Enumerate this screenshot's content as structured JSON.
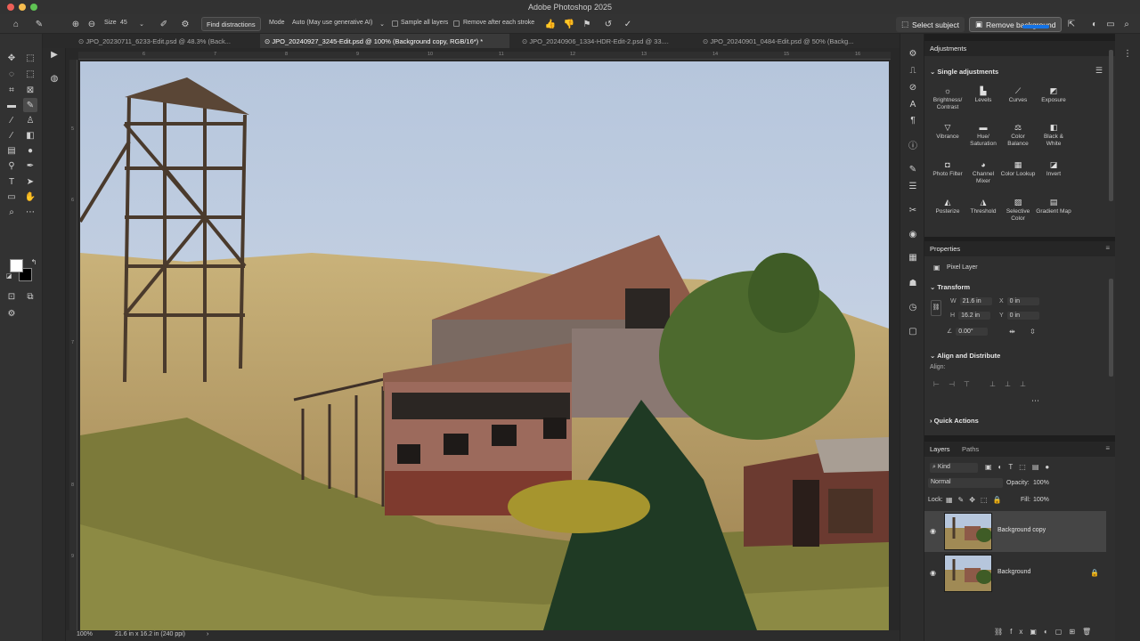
{
  "app": {
    "title": "Adobe Photoshop 2025"
  },
  "options": {
    "size_label": "Size",
    "size_value": "45",
    "find_distractions": "Find distractions",
    "mode_label": "Mode",
    "mode_value": "Auto (May use generative AI)",
    "sample_all_layers": "Sample all layers",
    "remove_after_stroke": "Remove after each stroke",
    "select_subject": "Select subject",
    "remove_background": "Remove background"
  },
  "tabs": [
    {
      "label": "JPO_20230711_6233-Edit.psd @ 48.3% (Back..."
    },
    {
      "label": "JPO_20240927_3245-Edit.psd @ 100% (Background copy, RGB/16*) *"
    },
    {
      "label": "JPO_20240906_1334-HDR-Edit-2.psd @ 33...."
    },
    {
      "label": "JPO_20240901_0484-Edit.psd @ 50% (Backg..."
    }
  ],
  "ruler": {
    "top": [
      "6",
      "7",
      "8",
      "9",
      "10",
      "11",
      "12",
      "13",
      "14",
      "15",
      "16"
    ],
    "left": [
      "5",
      "6",
      "7",
      "8",
      "9"
    ]
  },
  "status": {
    "zoom": "100%",
    "doc_size": "21.6 in x 16.2 in (240 ppi)"
  },
  "adjustments": {
    "title": "Adjustments",
    "section": "Single adjustments",
    "items": [
      {
        "label": "Brightness/ Contrast",
        "icon": "sun-icon"
      },
      {
        "label": "Levels",
        "icon": "levels-icon"
      },
      {
        "label": "Curves",
        "icon": "curves-icon"
      },
      {
        "label": "Exposure",
        "icon": "exposure-icon"
      },
      {
        "label": "Vibrance",
        "icon": "vibrance-icon"
      },
      {
        "label": "Hue/ Saturation",
        "icon": "hue-icon"
      },
      {
        "label": "Color Balance",
        "icon": "balance-icon"
      },
      {
        "label": "Black & White",
        "icon": "bw-icon"
      },
      {
        "label": "Photo Filter",
        "icon": "camera-icon"
      },
      {
        "label": "Channel Mixer",
        "icon": "mixer-icon"
      },
      {
        "label": "Color Lookup",
        "icon": "grid-icon"
      },
      {
        "label": "Invert",
        "icon": "invert-icon"
      },
      {
        "label": "Posterize",
        "icon": "posterize-icon"
      },
      {
        "label": "Threshold",
        "icon": "threshold-icon"
      },
      {
        "label": "Selective Color",
        "icon": "selective-icon"
      },
      {
        "label": "Gradient Map",
        "icon": "gradient-icon"
      }
    ]
  },
  "properties": {
    "title": "Properties",
    "layer_type": "Pixel Layer",
    "transform_label": "Transform",
    "w_label": "W",
    "w_value": "21.6 in",
    "h_label": "H",
    "h_value": "16.2 in",
    "x_label": "X",
    "x_value": "0 in",
    "y_label": "Y",
    "y_value": "0 in",
    "angle_value": "0.00°",
    "align_label": "Align and Distribute",
    "align_sub": "Align:",
    "quick_actions": "Quick Actions"
  },
  "layers": {
    "tab_layers": "Layers",
    "tab_paths": "Paths",
    "kind": "Kind",
    "blend_mode": "Normal",
    "opacity_label": "Opacity:",
    "opacity_value": "100%",
    "lock_label": "Lock:",
    "fill_label": "Fill:",
    "fill_value": "100%",
    "items": [
      {
        "name": "Background copy"
      },
      {
        "name": "Background"
      }
    ]
  }
}
